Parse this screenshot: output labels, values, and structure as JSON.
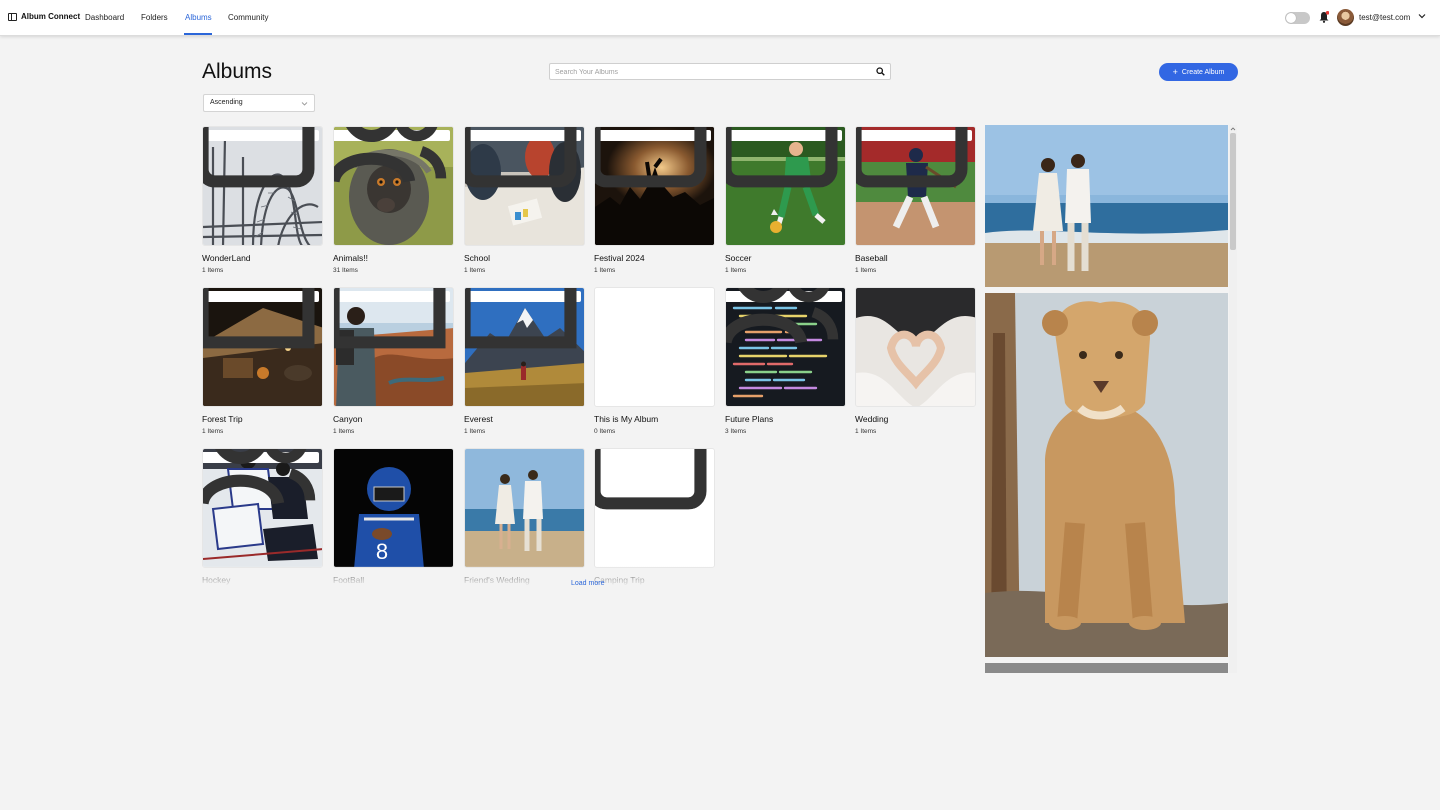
{
  "app": {
    "brand": "Album Connect",
    "nav": [
      {
        "label": "Dashboard",
        "active": false
      },
      {
        "label": "Folders",
        "active": false
      },
      {
        "label": "Albums",
        "active": true
      },
      {
        "label": "Community",
        "active": false
      }
    ],
    "user_email": "test@test.com",
    "theme_toggle_on": false,
    "accent_color": "#2b66d9",
    "button_color": "#3267e3"
  },
  "page": {
    "title": "Albums",
    "search_placeholder": "Search Your Albums",
    "create_label": "Create Album",
    "sort_value": "Ascending",
    "load_more": "Load more"
  },
  "albums": [
    {
      "name": "WonderLand",
      "count": "1 Items",
      "badges": [
        "card-icon"
      ]
    },
    {
      "name": "Animals!!",
      "count": "31 Items",
      "badges": [
        "card-icon",
        "shared-users-icon"
      ]
    },
    {
      "name": "School",
      "count": "1 Items",
      "badges": [
        "card-icon"
      ]
    },
    {
      "name": "Festival 2024",
      "count": "1 Items",
      "badges": [
        "card-icon"
      ]
    },
    {
      "name": "Soccer",
      "count": "1 Items",
      "badges": [
        "card-icon"
      ]
    },
    {
      "name": "Baseball",
      "count": "1 Items",
      "badges": [
        "card-icon"
      ]
    },
    {
      "name": "Forest Trip",
      "count": "1 Items",
      "badges": [
        "folder-icon"
      ]
    },
    {
      "name": "Canyon",
      "count": "1 Items",
      "badges": [
        "folder-icon"
      ]
    },
    {
      "name": "Everest",
      "count": "1 Items",
      "badges": [
        "folder-icon"
      ]
    },
    {
      "name": "This is My Album",
      "count": "0 Items",
      "badges": []
    },
    {
      "name": "Future Plans",
      "count": "3 Items",
      "badges": [
        "folder-icon",
        "shared-users-icon"
      ]
    },
    {
      "name": "Wedding",
      "count": "1 Items",
      "badges": []
    },
    {
      "name": "Hockey",
      "count": "",
      "badges": [
        "card-icon",
        "shared-users-icon"
      ]
    },
    {
      "name": "FootBall",
      "count": "",
      "badges": []
    },
    {
      "name": "Friend's Wedding",
      "count": "",
      "badges": []
    },
    {
      "name": "Camping Trip",
      "count": "",
      "badges": [
        "card-icon"
      ]
    }
  ],
  "preview": {
    "images": [
      "beach-couple-photo",
      "lioness-photo",
      "next-photo"
    ]
  }
}
